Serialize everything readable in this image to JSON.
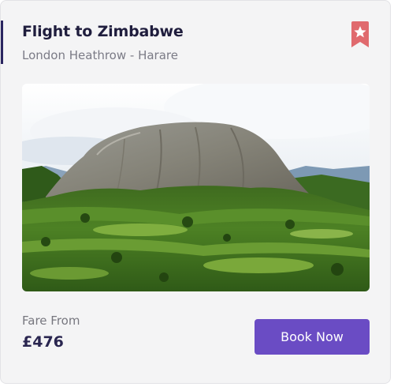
{
  "card": {
    "title": "Flight to Zimbabwe",
    "route": "London Heathrow - Harare",
    "bookmark_icon": "bookmark-star-icon",
    "image_subject": "Granite dome mountain over green savanna",
    "fare_label": "Fare From",
    "fare_price": "£476",
    "book_label": "Book Now"
  },
  "colors": {
    "accent_bar": "#2a2560",
    "bookmark": "#e06a6e",
    "button": "#6a4cc4",
    "title": "#1f1d3d"
  }
}
